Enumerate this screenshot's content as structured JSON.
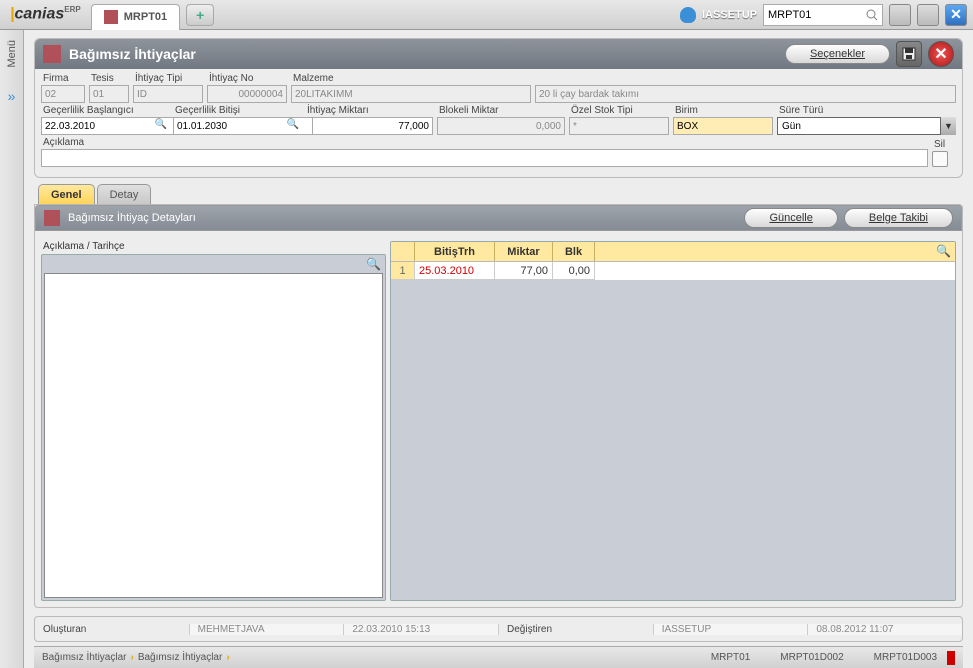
{
  "top": {
    "logo_text": "canias",
    "logo_sup": "ERP",
    "active_tab": "MRPT01",
    "user": "IASSETUP",
    "search_value": "MRPT01"
  },
  "side": {
    "menu": "Menü"
  },
  "header": {
    "title": "Bağımsız İhtiyaçlar",
    "options_btn": "Seçenekler"
  },
  "form": {
    "firma_lbl": "Firma",
    "firma": "02",
    "tesis_lbl": "Tesis",
    "tesis": "01",
    "ihtiyac_tipi_lbl": "İhtiyaç Tipi",
    "ihtiyac_tipi": "ID",
    "ihtiyac_no_lbl": "İhtiyaç No",
    "ihtiyac_no": "00000004",
    "malzeme_lbl": "Malzeme",
    "malzeme": "20LITAKIMM",
    "malzeme_desc": "20 li çay bardak takımı",
    "gec_bas_lbl": "Geçerlilik Başlangıcı",
    "gec_bas": "22.03.2010",
    "gec_bit_lbl": "Geçerlilik Bitişi",
    "gec_bit": "01.01.2030",
    "iht_miktar_lbl": "İhtiyaç Miktarı",
    "iht_miktar": "77,000",
    "blokeli_lbl": "Blokeli Miktar",
    "blokeli": "0,000",
    "ozel_stok_lbl": "Özel Stok Tipi",
    "ozel_stok": "*",
    "birim_lbl": "Birim",
    "birim": "BOX",
    "sure_lbl": "Süre Türü",
    "sure": "Gün",
    "aciklama_lbl": "Açıklama",
    "aciklama": "",
    "sil_lbl": "Sil"
  },
  "tabs": {
    "genel": "Genel",
    "detay": "Detay"
  },
  "subheader": {
    "title": "Bağımsız İhtiyaç Detayları",
    "guncelle": "Güncelle",
    "belge": "Belge Takibi"
  },
  "left_pane_lbl": "Açıklama / Tarihçe",
  "grid": {
    "cols": [
      "BitişTrh",
      "Miktar",
      "Blk"
    ],
    "rows": [
      {
        "n": "1",
        "bitis": "25.03.2010",
        "miktar": "77,00",
        "blk": "0,00"
      }
    ]
  },
  "footer": {
    "olusturan_lbl": "Oluşturan",
    "olusturan": "MEHMETJAVA",
    "olusturan_dt": "22.03.2010 15:13",
    "degistiren_lbl": "Değiştiren",
    "degistiren": "IASSETUP",
    "degistiren_dt": "08.08.2012 11:07"
  },
  "status": {
    "bc1": "Bağımsız İhtiyaçlar",
    "bc2": "Bağımsız İhtiyaçlar",
    "r1": "MRPT01",
    "r2": "MRPT01D002",
    "r3": "MRPT01D003"
  }
}
